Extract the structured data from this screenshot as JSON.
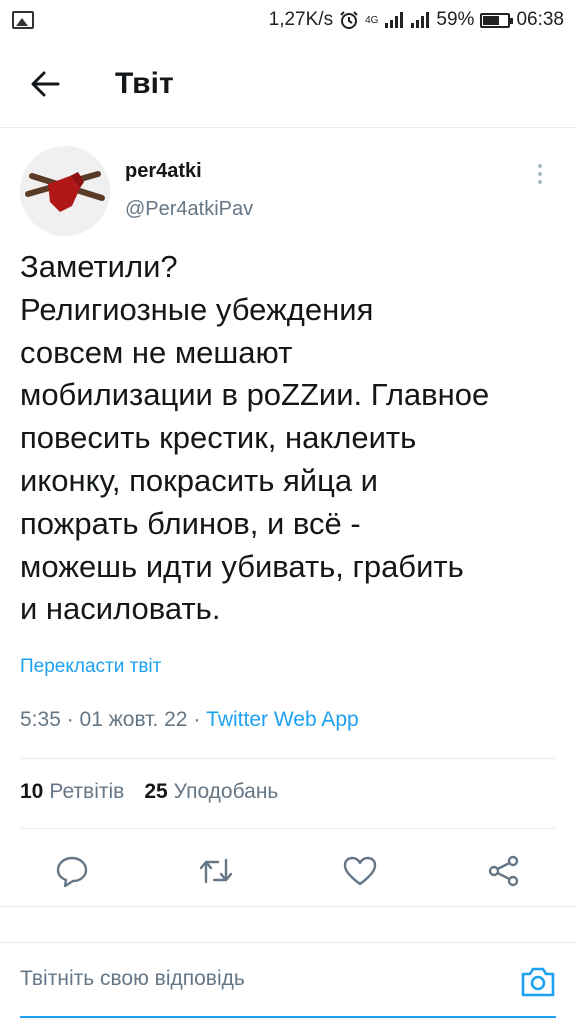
{
  "status_bar": {
    "speed": "1,27K/s",
    "network": "4G",
    "battery_percent": "59%",
    "battery_level": 0.59,
    "time": "06:38"
  },
  "header": {
    "title": "Твіт"
  },
  "tweet": {
    "author_name": "per4atki",
    "author_handle": "@Per4atkiPav",
    "text": "Заметили?\nРелигиозные убеждения\nсовсем не мешают\nмобилизации в роZZии. Главное\nповесить крестик, наклеить\nиконку, покрасить яйца и\nпожрать блинов, и всё -\nможешь идти убивать, грабить\nи насиловать.",
    "translate_label": "Перекласти твіт",
    "time": "5:35",
    "date": "01 жовт. 22",
    "source": "Twitter Web App",
    "retweet_count": "10",
    "retweet_label": "Ретвітів",
    "like_count": "25",
    "like_label": "Уподобань"
  },
  "reply": {
    "placeholder": "Твітніть свою відповідь"
  },
  "colors": {
    "accent": "#1da1f2",
    "secondary_text": "#657786",
    "primary_text": "#14171a",
    "divider": "#e6ecf0"
  },
  "icons": {
    "back": "arrow-left-icon",
    "more": "more-vertical-icon",
    "reply": "reply-icon",
    "retweet": "retweet-icon",
    "like": "heart-icon",
    "share": "share-icon",
    "camera": "camera-icon"
  }
}
